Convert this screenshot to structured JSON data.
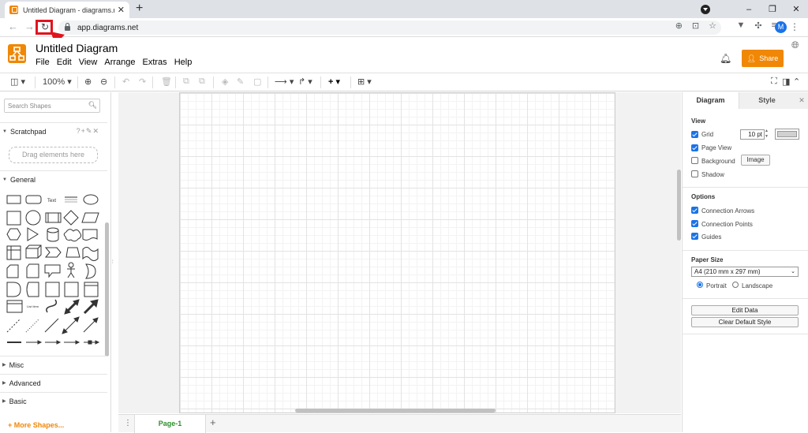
{
  "browser": {
    "tab_title": "Untitled Diagram - diagrams.net",
    "tab_close": "✕",
    "new_tab": "+",
    "url": "app.diagrams.net",
    "profile_initial": "M",
    "window_buttons": [
      "–",
      "❐",
      "✕"
    ]
  },
  "app": {
    "title": "Untitled Diagram",
    "menu": [
      "File",
      "Edit",
      "View",
      "Arrange",
      "Extras",
      "Help"
    ],
    "share_label": "Share",
    "brand_color": "#f08705"
  },
  "toolbar": {
    "zoom": "100%"
  },
  "sidebar": {
    "search_placeholder": "Search Shapes",
    "scratchpad": "Scratchpad",
    "scratchpad_tools": "?+✎✕",
    "drag_hint": "Drag elements here",
    "general": "General",
    "text_shape": "Text",
    "list_item_shape": "List Item",
    "sections": [
      "Misc",
      "Advanced",
      "Basic"
    ],
    "more_shapes": "+ More Shapes..."
  },
  "pages": {
    "active_page": "Page-1",
    "add": "+"
  },
  "format_panel": {
    "tabs": [
      "Diagram",
      "Style"
    ],
    "view_title": "View",
    "grid": {
      "label": "Grid",
      "checked": true,
      "size": "10 pt"
    },
    "page_view": {
      "label": "Page View",
      "checked": true
    },
    "background": {
      "label": "Background",
      "checked": false,
      "button": "Image"
    },
    "shadow": {
      "label": "Shadow",
      "checked": false
    },
    "options_title": "Options",
    "connection_arrows": {
      "label": "Connection Arrows",
      "checked": true
    },
    "connection_points": {
      "label": "Connection Points",
      "checked": true
    },
    "guides": {
      "label": "Guides",
      "checked": true
    },
    "paper_size_title": "Paper Size",
    "paper_size": "A4 (210 mm x 297 mm)",
    "portrait": "Portrait",
    "landscape": "Landscape",
    "edit_data": "Edit Data",
    "clear_default_style": "Clear Default Style"
  },
  "colors": {
    "accent": "#1a73e8",
    "page_tab_text": "#2d8f2d",
    "highlight_box": "#e0141e"
  }
}
